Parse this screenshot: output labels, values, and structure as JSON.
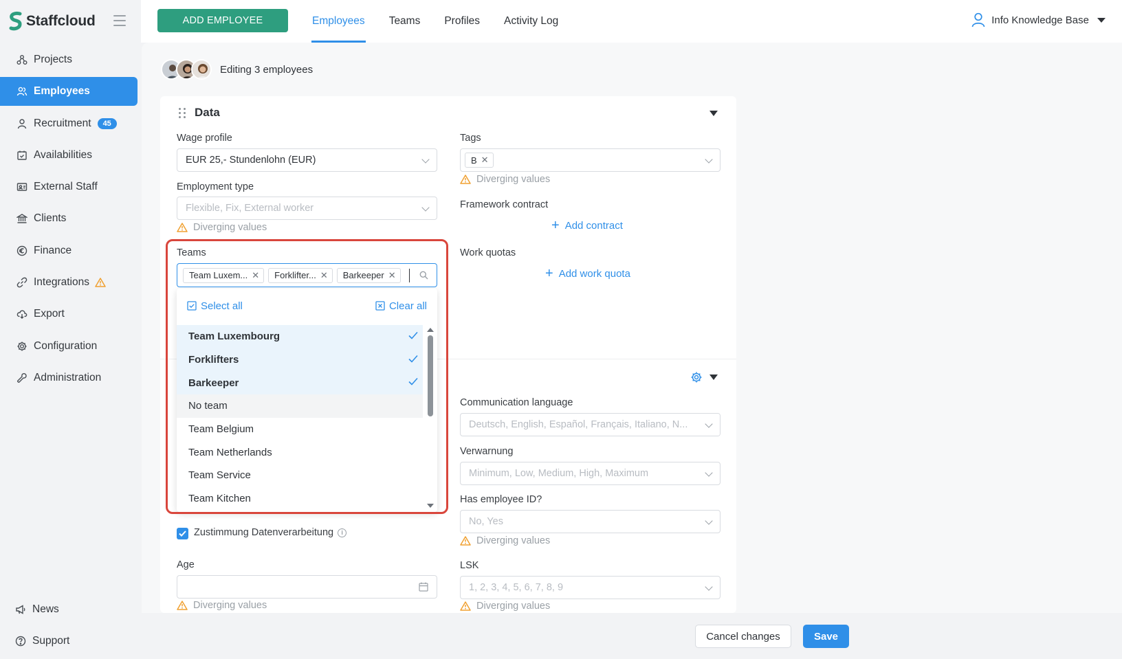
{
  "app": {
    "name": "Staffcloud"
  },
  "sidebar": {
    "items": [
      {
        "label": "Projects",
        "icon": "projects-icon"
      },
      {
        "label": "Employees",
        "icon": "employees-icon",
        "active": true
      },
      {
        "label": "Recruitment",
        "icon": "recruitment-icon",
        "badge": "45"
      },
      {
        "label": "Availabilities",
        "icon": "calendar-check-icon"
      },
      {
        "label": "External Staff",
        "icon": "id-card-icon"
      },
      {
        "label": "Clients",
        "icon": "bank-icon"
      },
      {
        "label": "Finance",
        "icon": "finance-icon"
      },
      {
        "label": "Integrations",
        "icon": "link-icon",
        "warning": true
      },
      {
        "label": "Export",
        "icon": "cloud-download-icon"
      },
      {
        "label": "Configuration",
        "icon": "gear-icon"
      },
      {
        "label": "Administration",
        "icon": "wrench-icon"
      }
    ],
    "bottom": [
      {
        "label": "News",
        "icon": "megaphone-icon"
      },
      {
        "label": "Support",
        "icon": "help-icon"
      }
    ]
  },
  "topbar": {
    "add_button": "ADD EMPLOYEE",
    "tabs": [
      "Employees",
      "Teams",
      "Profiles",
      "Activity Log"
    ],
    "active_tab": "Employees",
    "user": "Info Knowledge Base"
  },
  "editing": {
    "text": "Editing 3 employees"
  },
  "data_section": {
    "title": "Data",
    "wage_profile": {
      "label": "Wage profile",
      "value": "EUR 25,- Stundenlohn (EUR)"
    },
    "employment_type": {
      "label": "Employment type",
      "placeholder": "Flexible, Fix, External worker",
      "warning": "Diverging values"
    },
    "teams": {
      "label": "Teams",
      "chips": [
        "Team Luxem...",
        "Forklifter...",
        "Barkeeper"
      ],
      "select_all": "Select all",
      "clear_all": "Clear all",
      "options": [
        {
          "label": "Team Luxembourg",
          "selected": true
        },
        {
          "label": "Forklifters",
          "selected": true
        },
        {
          "label": "Barkeeper",
          "selected": true
        },
        {
          "label": "No team",
          "selected": false
        },
        {
          "label": "Team Belgium",
          "selected": false
        },
        {
          "label": "Team Netherlands",
          "selected": false
        },
        {
          "label": "Team Service",
          "selected": false
        },
        {
          "label": "Team Kitchen",
          "selected": false
        }
      ]
    },
    "tags": {
      "label": "Tags",
      "chips": [
        "B"
      ],
      "warning": "Diverging values"
    },
    "framework_contract": {
      "label": "Framework contract",
      "add": "Add contract"
    },
    "work_quotas": {
      "label": "Work quotas",
      "add": "Add work quota"
    }
  },
  "second_section": {
    "communication_language": {
      "label": "Communication language",
      "placeholder": "Deutsch, English, Español, Français, Italiano, N..."
    },
    "verwarnung": {
      "label": "Verwarnung",
      "placeholder": "Minimum, Low, Medium, High, Maximum"
    },
    "has_employee_id": {
      "label": "Has employee ID?",
      "placeholder": "No, Yes",
      "warning": "Diverging values"
    },
    "consent": {
      "label": "Zustimmung Datenverarbeitung",
      "checked": true
    },
    "age": {
      "label": "Age",
      "value": "",
      "warning": "Diverging values"
    },
    "lsk": {
      "label": "LSK",
      "placeholder": "1, 2, 3, 4, 5, 6, 7, 8, 9",
      "warning": "Diverging values"
    }
  },
  "footer": {
    "cancel": "Cancel changes",
    "save": "Save"
  },
  "colors": {
    "accent": "#2f8fe8",
    "brand_green": "#2e9e7f",
    "warning": "#f0a030",
    "highlight": "#d9463c"
  }
}
